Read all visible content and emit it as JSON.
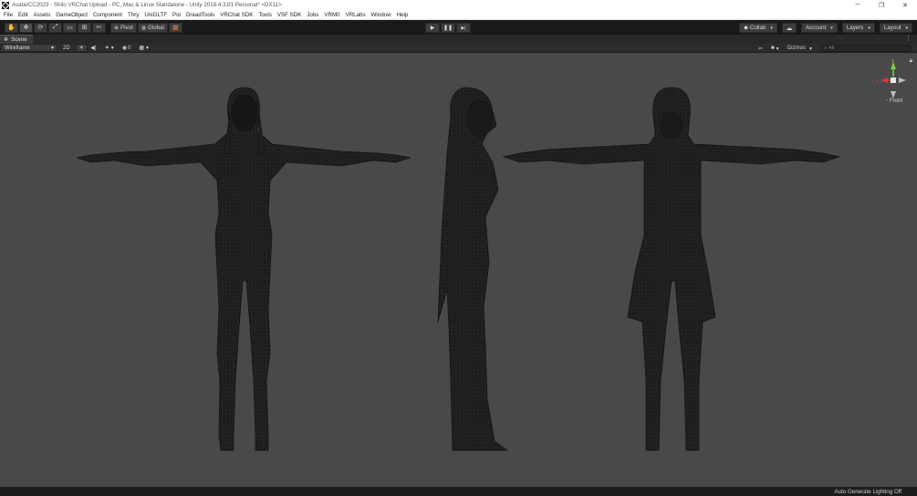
{
  "window": {
    "title": "AvatarCC2023 - Shilo VRChat Upload - PC, Mac & Linux Standalone - Unity 2019.4.31f1 Personal* <DX11>",
    "minimize": "─",
    "maximize": "❐",
    "close": "✕"
  },
  "menu": [
    "File",
    "Edit",
    "Assets",
    "GameObject",
    "Component",
    "Thry",
    "UniGLTF",
    "Poi",
    "DreadTools",
    "VRChat SDK",
    "Tools",
    "VSF SDK",
    "Jobs",
    "VRM0",
    "VRLabs",
    "Window",
    "Help"
  ],
  "toolbar": {
    "tools": [
      {
        "name": "hand-tool-icon",
        "glyph": "✋"
      },
      {
        "name": "move-tool-icon",
        "glyph": "✥"
      },
      {
        "name": "rotate-tool-icon",
        "glyph": "⟳"
      },
      {
        "name": "scale-tool-icon",
        "glyph": "⤢"
      },
      {
        "name": "rect-tool-icon",
        "glyph": "▭"
      },
      {
        "name": "transform-tool-icon",
        "glyph": "⊞"
      },
      {
        "name": "custom-tool-icon",
        "glyph": "✂"
      }
    ],
    "pivot_label": "Pivot",
    "global_label": "Global",
    "snap_glyph": "▦",
    "play_glyph": "▶",
    "pause_glyph": "❚❚",
    "step_glyph": "▶|",
    "collab_label": "Collab",
    "cloud_glyph": "☁",
    "account_label": "Account",
    "layers_label": "Layers",
    "layout_label": "Layout",
    "caret": "▾"
  },
  "scene_tab": {
    "label": "Scene",
    "menu_glyph": "⋮"
  },
  "scene_toolbar": {
    "draw_mode": "Wireframe",
    "mode_2d": "2D",
    "light_glyph": "☀",
    "audio_glyph": "◀)",
    "effects_glyph": "✦",
    "hidden_count": "0",
    "grid_glyph": "▦",
    "tools_glyph": "✂",
    "camera_glyph": "■",
    "gizmos_label": "Gizmos",
    "search_placeholder": "All"
  },
  "gizmo": {
    "view_label": "Front",
    "x_axis": "x",
    "y_axis": "y",
    "colors": {
      "x": "#d63c3c",
      "y": "#7ccf3e",
      "z": "#4a7fe0"
    }
  },
  "status": {
    "text": "Auto Generate Lighting Off"
  }
}
